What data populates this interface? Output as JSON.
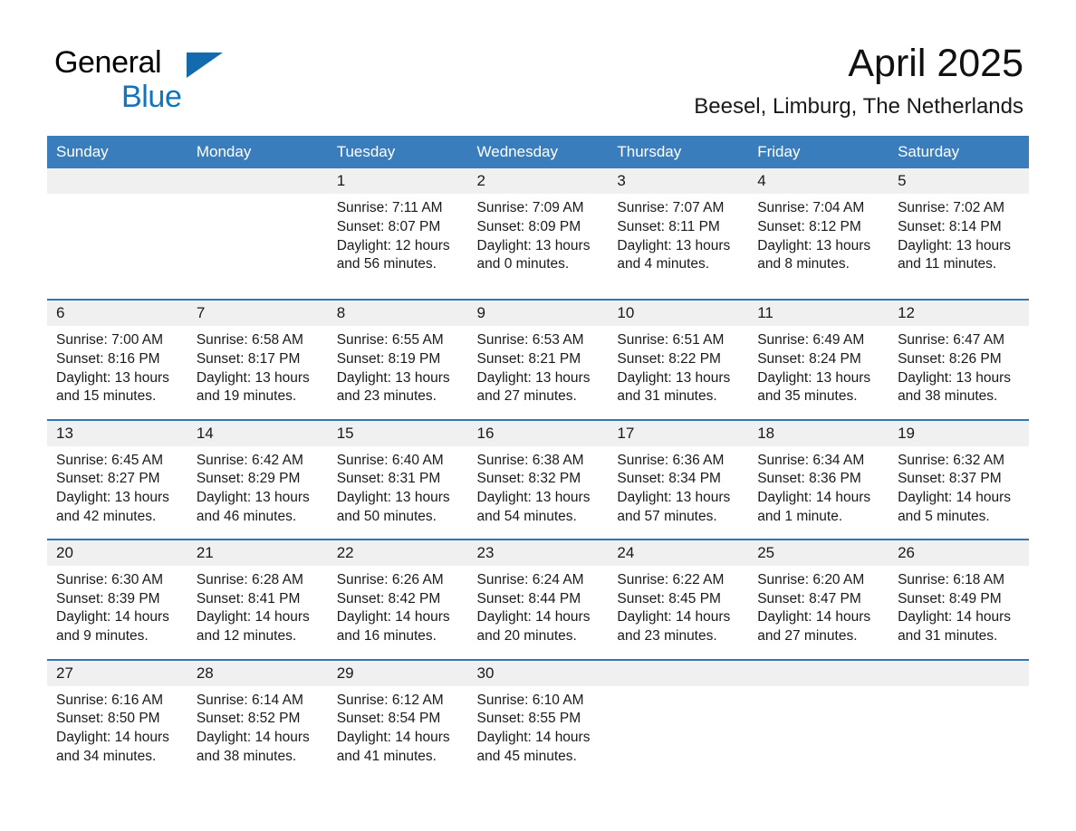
{
  "brand": {
    "name_top": "General",
    "name_bottom": "Blue",
    "accent_color": "#1274bd",
    "triangle_color": "#136aad"
  },
  "header": {
    "month_title": "April 2025",
    "location": "Beesel, Limburg, The Netherlands"
  },
  "theme": {
    "header_bg": "#3a7dbd",
    "header_text": "#ffffff",
    "week_separator": "#2e76b4",
    "daynum_band_bg": "#f0f0f0",
    "cell_bg": "#ffffff",
    "text": "#1a1a1a"
  },
  "weekdays": [
    "Sunday",
    "Monday",
    "Tuesday",
    "Wednesday",
    "Thursday",
    "Friday",
    "Saturday"
  ],
  "labels": {
    "sunrise_prefix": "Sunrise:",
    "sunset_prefix": "Sunset:",
    "daylight_prefix": "Daylight:"
  },
  "weeks": [
    {
      "days": [
        {
          "empty": true
        },
        {
          "empty": true
        },
        {
          "date": "1",
          "sunrise": "Sunrise: 7:11 AM",
          "sunset": "Sunset: 8:07 PM",
          "daylight_line1": "Daylight: 12 hours",
          "daylight_line2": "and 56 minutes."
        },
        {
          "date": "2",
          "sunrise": "Sunrise: 7:09 AM",
          "sunset": "Sunset: 8:09 PM",
          "daylight_line1": "Daylight: 13 hours",
          "daylight_line2": "and 0 minutes."
        },
        {
          "date": "3",
          "sunrise": "Sunrise: 7:07 AM",
          "sunset": "Sunset: 8:11 PM",
          "daylight_line1": "Daylight: 13 hours",
          "daylight_line2": "and 4 minutes."
        },
        {
          "date": "4",
          "sunrise": "Sunrise: 7:04 AM",
          "sunset": "Sunset: 8:12 PM",
          "daylight_line1": "Daylight: 13 hours",
          "daylight_line2": "and 8 minutes."
        },
        {
          "date": "5",
          "sunrise": "Sunrise: 7:02 AM",
          "sunset": "Sunset: 8:14 PM",
          "daylight_line1": "Daylight: 13 hours",
          "daylight_line2": "and 11 minutes."
        }
      ]
    },
    {
      "days": [
        {
          "date": "6",
          "sunrise": "Sunrise: 7:00 AM",
          "sunset": "Sunset: 8:16 PM",
          "daylight_line1": "Daylight: 13 hours",
          "daylight_line2": "and 15 minutes."
        },
        {
          "date": "7",
          "sunrise": "Sunrise: 6:58 AM",
          "sunset": "Sunset: 8:17 PM",
          "daylight_line1": "Daylight: 13 hours",
          "daylight_line2": "and 19 minutes."
        },
        {
          "date": "8",
          "sunrise": "Sunrise: 6:55 AM",
          "sunset": "Sunset: 8:19 PM",
          "daylight_line1": "Daylight: 13 hours",
          "daylight_line2": "and 23 minutes."
        },
        {
          "date": "9",
          "sunrise": "Sunrise: 6:53 AM",
          "sunset": "Sunset: 8:21 PM",
          "daylight_line1": "Daylight: 13 hours",
          "daylight_line2": "and 27 minutes."
        },
        {
          "date": "10",
          "sunrise": "Sunrise: 6:51 AM",
          "sunset": "Sunset: 8:22 PM",
          "daylight_line1": "Daylight: 13 hours",
          "daylight_line2": "and 31 minutes."
        },
        {
          "date": "11",
          "sunrise": "Sunrise: 6:49 AM",
          "sunset": "Sunset: 8:24 PM",
          "daylight_line1": "Daylight: 13 hours",
          "daylight_line2": "and 35 minutes."
        },
        {
          "date": "12",
          "sunrise": "Sunrise: 6:47 AM",
          "sunset": "Sunset: 8:26 PM",
          "daylight_line1": "Daylight: 13 hours",
          "daylight_line2": "and 38 minutes."
        }
      ]
    },
    {
      "days": [
        {
          "date": "13",
          "sunrise": "Sunrise: 6:45 AM",
          "sunset": "Sunset: 8:27 PM",
          "daylight_line1": "Daylight: 13 hours",
          "daylight_line2": "and 42 minutes."
        },
        {
          "date": "14",
          "sunrise": "Sunrise: 6:42 AM",
          "sunset": "Sunset: 8:29 PM",
          "daylight_line1": "Daylight: 13 hours",
          "daylight_line2": "and 46 minutes."
        },
        {
          "date": "15",
          "sunrise": "Sunrise: 6:40 AM",
          "sunset": "Sunset: 8:31 PM",
          "daylight_line1": "Daylight: 13 hours",
          "daylight_line2": "and 50 minutes."
        },
        {
          "date": "16",
          "sunrise": "Sunrise: 6:38 AM",
          "sunset": "Sunset: 8:32 PM",
          "daylight_line1": "Daylight: 13 hours",
          "daylight_line2": "and 54 minutes."
        },
        {
          "date": "17",
          "sunrise": "Sunrise: 6:36 AM",
          "sunset": "Sunset: 8:34 PM",
          "daylight_line1": "Daylight: 13 hours",
          "daylight_line2": "and 57 minutes."
        },
        {
          "date": "18",
          "sunrise": "Sunrise: 6:34 AM",
          "sunset": "Sunset: 8:36 PM",
          "daylight_line1": "Daylight: 14 hours",
          "daylight_line2": "and 1 minute."
        },
        {
          "date": "19",
          "sunrise": "Sunrise: 6:32 AM",
          "sunset": "Sunset: 8:37 PM",
          "daylight_line1": "Daylight: 14 hours",
          "daylight_line2": "and 5 minutes."
        }
      ]
    },
    {
      "days": [
        {
          "date": "20",
          "sunrise": "Sunrise: 6:30 AM",
          "sunset": "Sunset: 8:39 PM",
          "daylight_line1": "Daylight: 14 hours",
          "daylight_line2": "and 9 minutes."
        },
        {
          "date": "21",
          "sunrise": "Sunrise: 6:28 AM",
          "sunset": "Sunset: 8:41 PM",
          "daylight_line1": "Daylight: 14 hours",
          "daylight_line2": "and 12 minutes."
        },
        {
          "date": "22",
          "sunrise": "Sunrise: 6:26 AM",
          "sunset": "Sunset: 8:42 PM",
          "daylight_line1": "Daylight: 14 hours",
          "daylight_line2": "and 16 minutes."
        },
        {
          "date": "23",
          "sunrise": "Sunrise: 6:24 AM",
          "sunset": "Sunset: 8:44 PM",
          "daylight_line1": "Daylight: 14 hours",
          "daylight_line2": "and 20 minutes."
        },
        {
          "date": "24",
          "sunrise": "Sunrise: 6:22 AM",
          "sunset": "Sunset: 8:45 PM",
          "daylight_line1": "Daylight: 14 hours",
          "daylight_line2": "and 23 minutes."
        },
        {
          "date": "25",
          "sunrise": "Sunrise: 6:20 AM",
          "sunset": "Sunset: 8:47 PM",
          "daylight_line1": "Daylight: 14 hours",
          "daylight_line2": "and 27 minutes."
        },
        {
          "date": "26",
          "sunrise": "Sunrise: 6:18 AM",
          "sunset": "Sunset: 8:49 PM",
          "daylight_line1": "Daylight: 14 hours",
          "daylight_line2": "and 31 minutes."
        }
      ]
    },
    {
      "days": [
        {
          "date": "27",
          "sunrise": "Sunrise: 6:16 AM",
          "sunset": "Sunset: 8:50 PM",
          "daylight_line1": "Daylight: 14 hours",
          "daylight_line2": "and 34 minutes."
        },
        {
          "date": "28",
          "sunrise": "Sunrise: 6:14 AM",
          "sunset": "Sunset: 8:52 PM",
          "daylight_line1": "Daylight: 14 hours",
          "daylight_line2": "and 38 minutes."
        },
        {
          "date": "29",
          "sunrise": "Sunrise: 6:12 AM",
          "sunset": "Sunset: 8:54 PM",
          "daylight_line1": "Daylight: 14 hours",
          "daylight_line2": "and 41 minutes."
        },
        {
          "date": "30",
          "sunrise": "Sunrise: 6:10 AM",
          "sunset": "Sunset: 8:55 PM",
          "daylight_line1": "Daylight: 14 hours",
          "daylight_line2": "and 45 minutes."
        },
        {
          "empty": true
        },
        {
          "empty": true
        },
        {
          "empty": true
        }
      ]
    }
  ]
}
